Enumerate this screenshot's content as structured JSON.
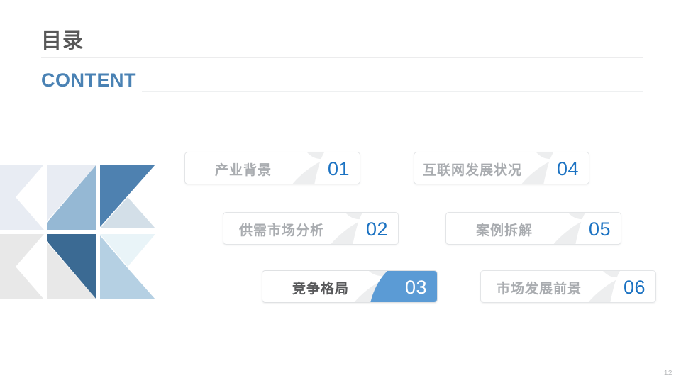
{
  "slide": {
    "page_number": "12",
    "heading_cn": "目录",
    "heading_en": "CONTENT",
    "colors": {
      "heading_cn": "#585858",
      "heading_en": "#4A82B4",
      "number_blue": "#1B72C2",
      "accent_blue": "#5B9BD5",
      "swoosh_gray": "#EDEEEF",
      "rule_gray": "#ECECED",
      "label_gray": "#A9ACB0",
      "label_active": "#58595B",
      "page_number_gray": "#B6B8BA"
    }
  },
  "contents": {
    "items": [
      {
        "number": "01",
        "label": "产业背景",
        "active": false
      },
      {
        "number": "02",
        "label": "供需市场分析",
        "active": false
      },
      {
        "number": "03",
        "label": "竞争格局",
        "active": true
      },
      {
        "number": "04",
        "label": "互联网发展状况",
        "active": false
      },
      {
        "number": "05",
        "label": "案例拆解",
        "active": false
      },
      {
        "number": "06",
        "label": "市场发展前景",
        "active": false
      }
    ]
  },
  "decoration": {
    "name": "triangle-mosaic",
    "tiles": [
      "#E8ECF3",
      "#E8ECF3",
      "#95B8D4",
      "#4E81B0",
      "#D3DFE8",
      "#FFFFFF",
      "#E8E8E8",
      "#E8E8E8",
      "#3B6A93",
      "#E9F4F8",
      "#B5D0E3",
      "#FFFFFF"
    ]
  }
}
